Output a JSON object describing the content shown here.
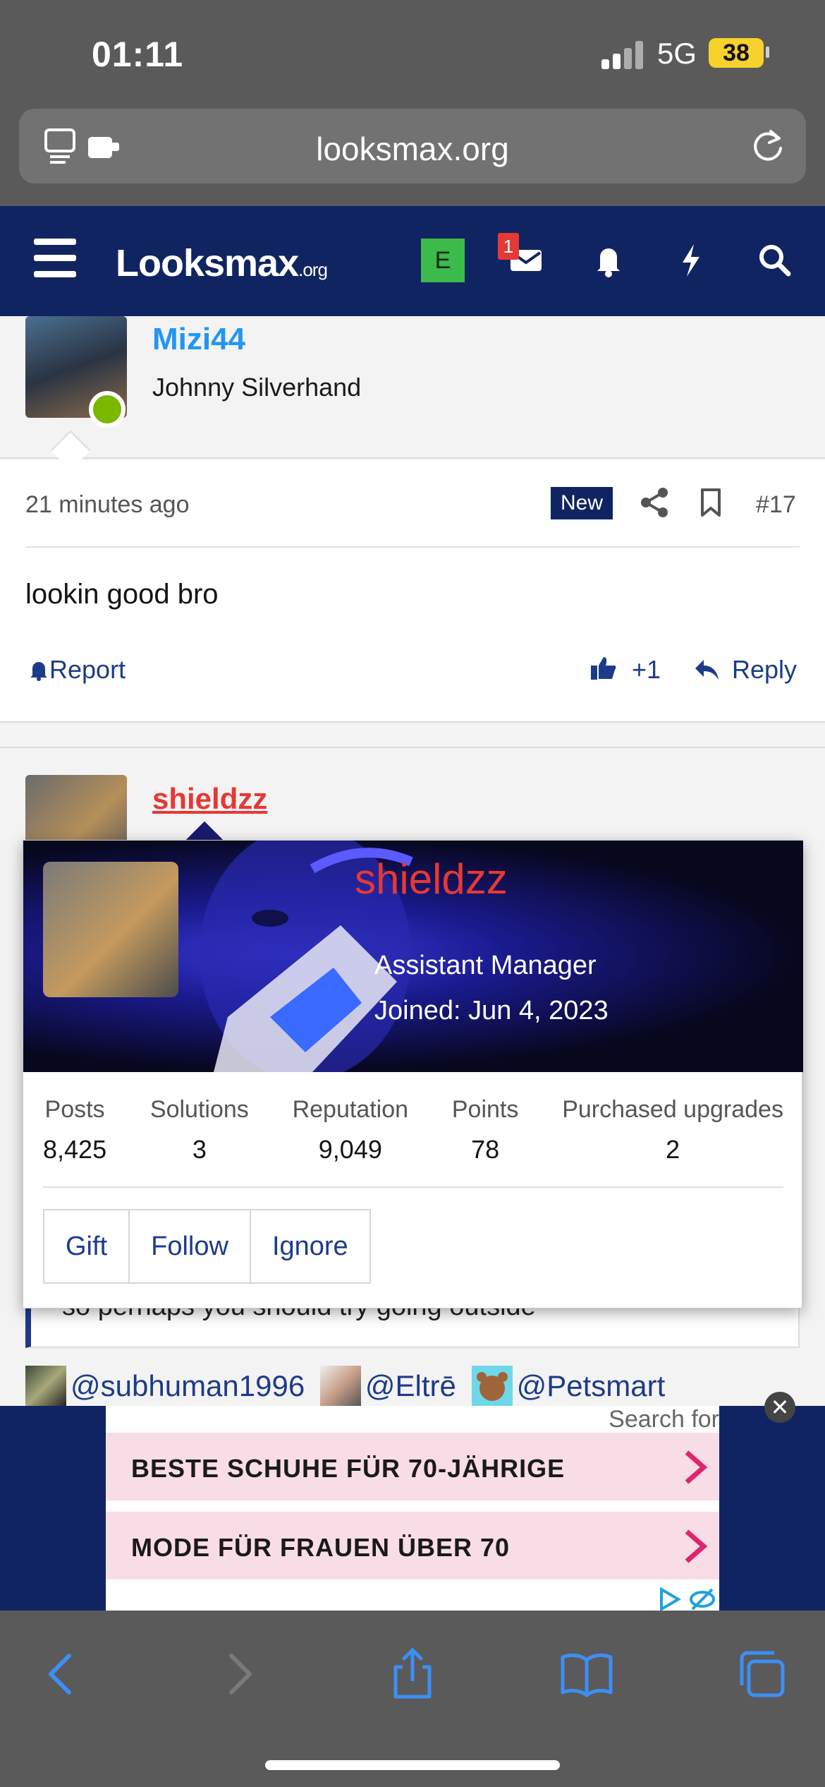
{
  "status": {
    "time": "01:11",
    "network": "5G",
    "battery": "38"
  },
  "browser": {
    "url": "looksmax.org"
  },
  "nav": {
    "logo_main": "Looksmax",
    "logo_suffix": ".org",
    "badge_letter": "E",
    "message_count": "1"
  },
  "post1": {
    "author": "Mizi44",
    "user_title": "Johnny Silverhand",
    "time": "21 minutes ago",
    "new_label": "New",
    "post_number": "#17",
    "text": "lookin good bro",
    "report_label": "Report",
    "like_label": "+1",
    "reply_label": "Reply"
  },
  "post2": {
    "author": "shieldzz"
  },
  "member_card": {
    "name": "shieldzz",
    "role": "Assistant Manager",
    "joined": "Joined: Jun 4, 2023",
    "stats": [
      {
        "label": "Posts",
        "value": "8,425"
      },
      {
        "label": "Solutions",
        "value": "3"
      },
      {
        "label": "Reputation",
        "value": "9,049"
      },
      {
        "label": "Points",
        "value": "78"
      },
      {
        "label": "Purchased upgrades",
        "value": "2"
      }
    ],
    "buttons": [
      "Gift",
      "Follow",
      "Ignore"
    ]
  },
  "quote": {
    "text": "so perhaps you should try going outside"
  },
  "mentions": [
    "@subhuman1996",
    "@Eltrē",
    "@Petsmart"
  ],
  "ad": {
    "search_label": "Search for",
    "rows": [
      "BESTE SCHUHE FÜR 70-JÄHRIGE",
      "MODE FÜR FRAUEN ÜBER 70"
    ],
    "close_symbol": "✕"
  },
  "icons": {
    "tabs": "tabs-icon",
    "share": "share-icon",
    "reload": "reload-icon",
    "menu": "hamburger-icon",
    "mail": "mail-icon",
    "bell": "bell-icon",
    "bolt": "bolt-icon",
    "search": "search-icon",
    "bookmark": "bookmark-icon",
    "back": "back-icon",
    "forward": "forward-icon",
    "book": "bookmarks-icon",
    "pages": "tab-overview-icon"
  },
  "colors": {
    "nav": "#112462",
    "link": "#1d3b8a",
    "username_red": "#e53935",
    "username_blue": "#2196f3",
    "online": "#7ab800"
  }
}
